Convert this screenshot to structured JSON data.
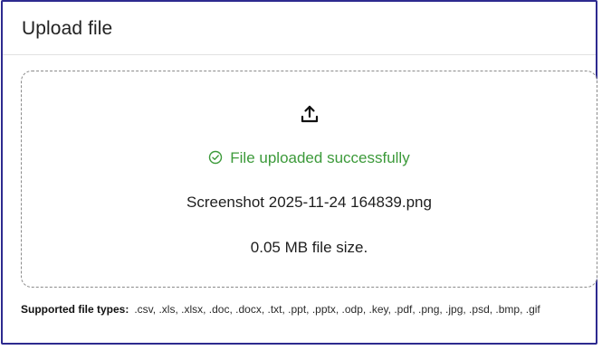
{
  "header": {
    "title": "Upload file"
  },
  "dropzone": {
    "upload_icon": "upload-icon",
    "status_icon": "check-circle-icon",
    "status_text": "File uploaded successfully",
    "file_name": "Screenshot 2025-11-24 164839.png",
    "file_size": "0.05 MB file size."
  },
  "supported": {
    "label": "Supported file types:",
    "types": ".csv, .xls, .xlsx, .doc, .docx, .txt, .ppt, .pptx, .odp, .key, .pdf, .png, .jpg, .psd, .bmp, .gif"
  },
  "colors": {
    "frame_border": "#2d2a8f",
    "success": "#3c9a3a",
    "dropzone_border": "#8b8b8b"
  }
}
